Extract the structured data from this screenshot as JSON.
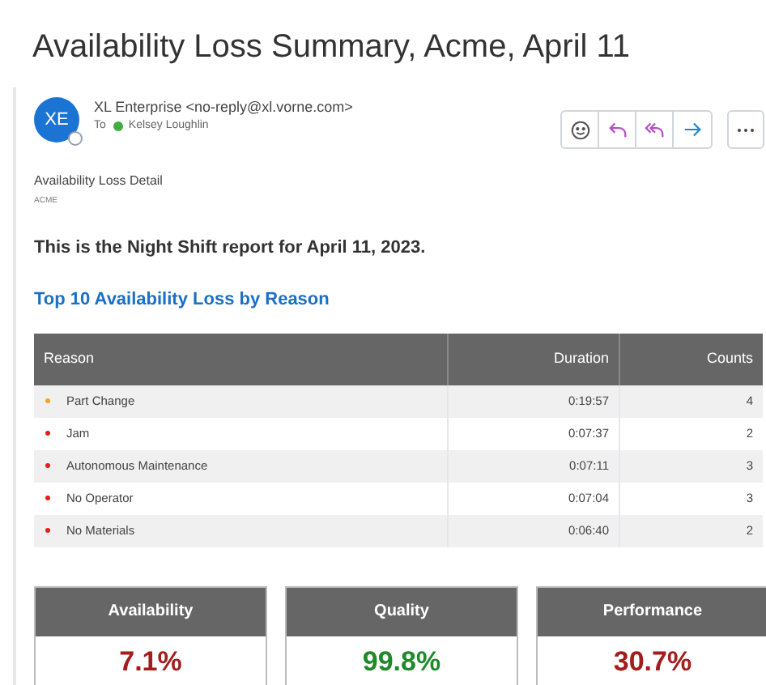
{
  "title": "Availability Loss Summary, Acme, April 11",
  "sender": {
    "avatar": "XE",
    "from": "XL Enterprise <no-reply@xl.vorne.com>",
    "to_label": "To",
    "recipient": "Kelsey Loughlin"
  },
  "body": {
    "heading": "Availability Loss Detail",
    "subheading": "ACME",
    "intro": "This is the Night Shift report for April 11, 2023.",
    "section_title": "Top 10 Availability Loss by Reason"
  },
  "table": {
    "columns": [
      "Reason",
      "Duration",
      "Counts"
    ],
    "rows": [
      {
        "reason": "Part Change",
        "duration": "0:19:57",
        "counts": "4",
        "color": "#f5a623"
      },
      {
        "reason": "Jam",
        "duration": "0:07:37",
        "counts": "2",
        "color": "#e0201b"
      },
      {
        "reason": "Autonomous Maintenance",
        "duration": "0:07:11",
        "counts": "3",
        "color": "#e0201b"
      },
      {
        "reason": "No Operator",
        "duration": "0:07:04",
        "counts": "3",
        "color": "#e0201b"
      },
      {
        "reason": "No Materials",
        "duration": "0:06:40",
        "counts": "2",
        "color": "#e0201b"
      }
    ]
  },
  "metrics": [
    {
      "label": "Availability",
      "value": "7.1%",
      "color": "#a31d1d"
    },
    {
      "label": "Quality",
      "value": "99.8%",
      "color": "#1f8a2a"
    },
    {
      "label": "Performance",
      "value": "30.7%",
      "color": "#a31d1d"
    }
  ]
}
